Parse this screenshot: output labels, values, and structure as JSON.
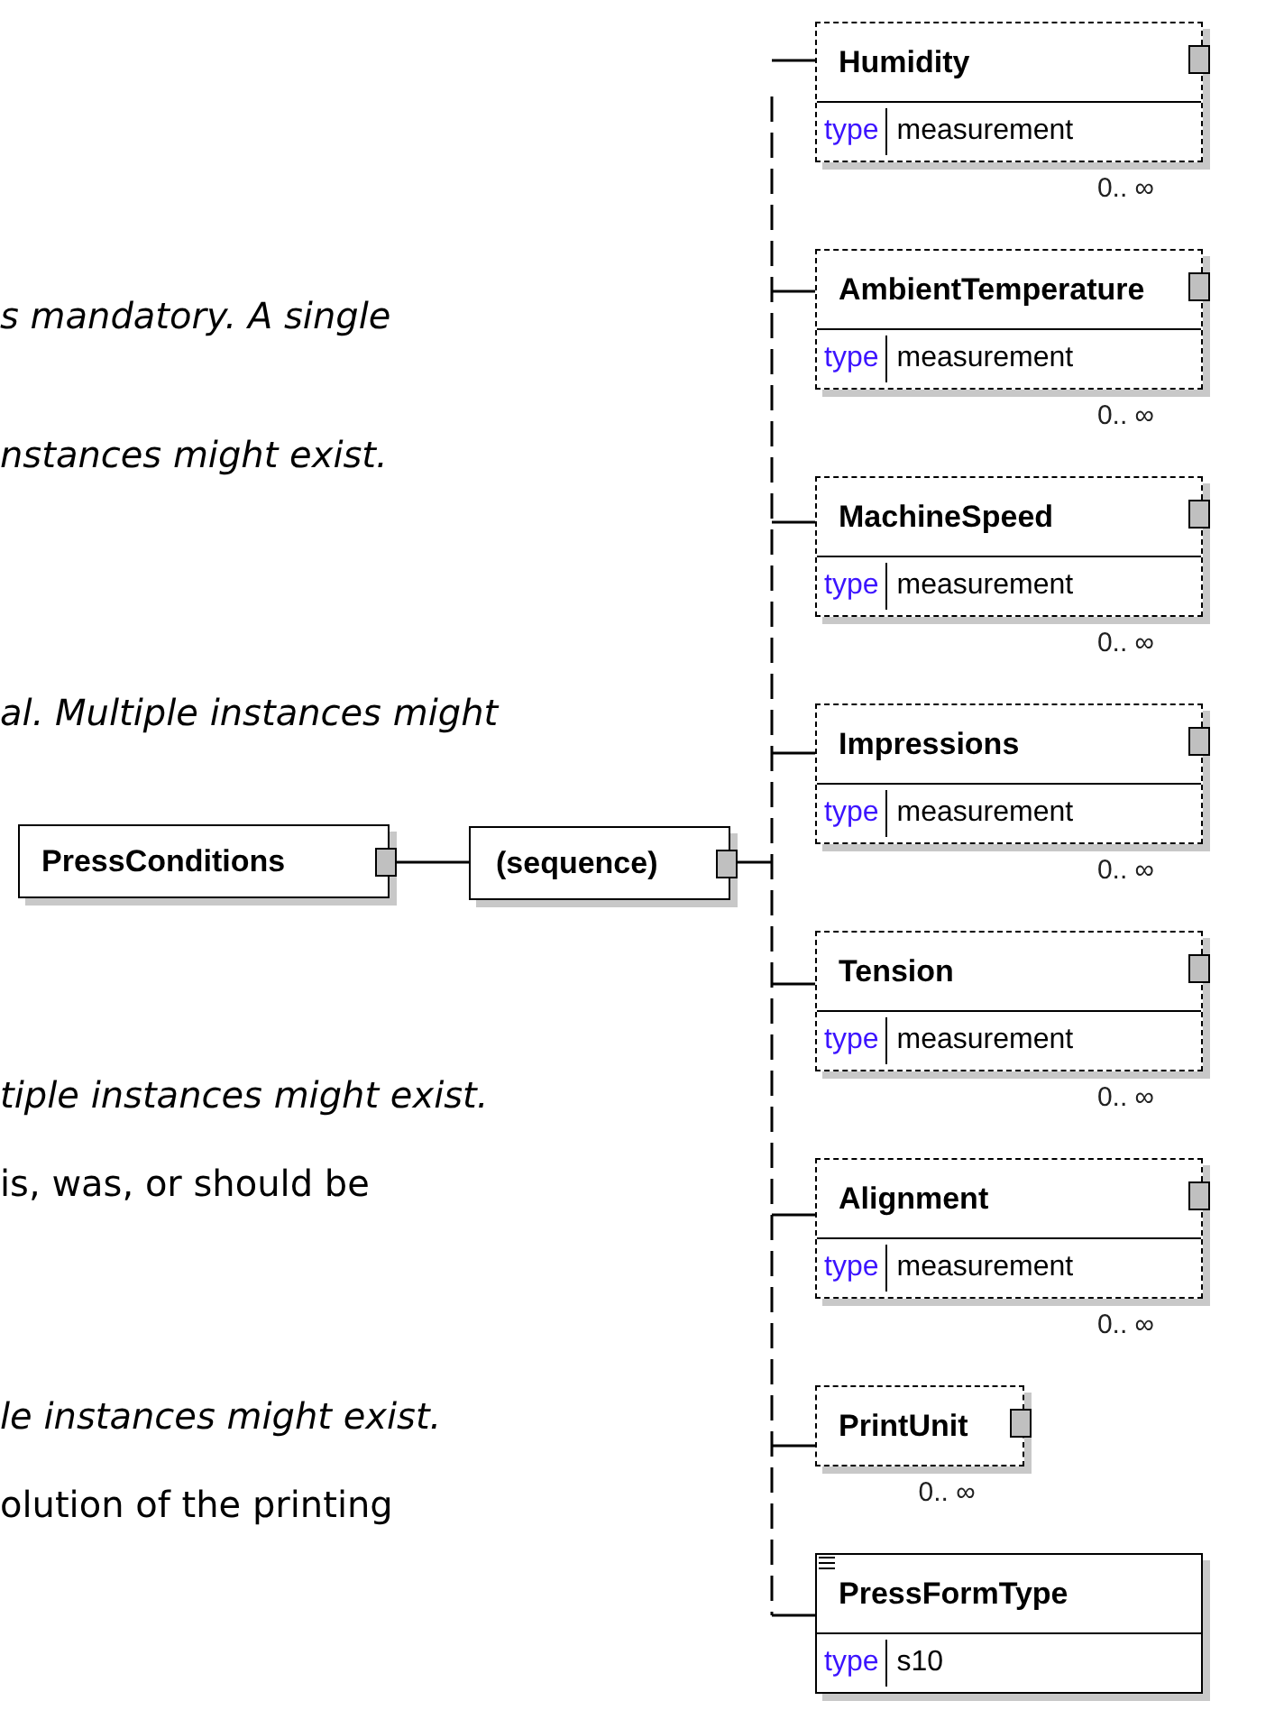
{
  "text_fragments": [
    {
      "text": "s mandatory. A single",
      "italic": true
    },
    {
      "text": "nstances might exist.",
      "italic": true
    },
    {
      "text": "al. Multiple instances might",
      "italic": true
    },
    {
      "text": "tiple instances might exist.",
      "italic": true
    },
    {
      "text": "is, was, or should be",
      "italic": false
    },
    {
      "text": "le instances might exist.",
      "italic": true
    },
    {
      "text": "olution of the printing",
      "italic": false
    }
  ],
  "root": {
    "name": "PressConditions"
  },
  "compositor": {
    "label": "(sequence)"
  },
  "elements": [
    {
      "name": "Humidity",
      "type_label": "type",
      "type": "measurement",
      "occurs": "0.. ∞",
      "optional": true,
      "expandable": true,
      "annotated": false
    },
    {
      "name": "AmbientTemperature",
      "type_label": "type",
      "type": "measurement",
      "occurs": "0.. ∞",
      "optional": true,
      "expandable": true,
      "annotated": false
    },
    {
      "name": "MachineSpeed",
      "type_label": "type",
      "type": "measurement",
      "occurs": "0.. ∞",
      "optional": true,
      "expandable": true,
      "annotated": false
    },
    {
      "name": "Impressions",
      "type_label": "type",
      "type": "measurement",
      "occurs": "0.. ∞",
      "optional": true,
      "expandable": true,
      "annotated": false
    },
    {
      "name": "Tension",
      "type_label": "type",
      "type": "measurement",
      "occurs": "0.. ∞",
      "optional": true,
      "expandable": true,
      "annotated": false
    },
    {
      "name": "Alignment",
      "type_label": "type",
      "type": "measurement",
      "occurs": "0.. ∞",
      "optional": true,
      "expandable": true,
      "annotated": false
    },
    {
      "name": "PrintUnit",
      "occurs": "0.. ∞",
      "optional": true,
      "expandable": true,
      "annotated": false
    },
    {
      "name": "PressFormType",
      "type_label": "type",
      "type": "s10",
      "optional": false,
      "expandable": false,
      "annotated": true
    }
  ]
}
